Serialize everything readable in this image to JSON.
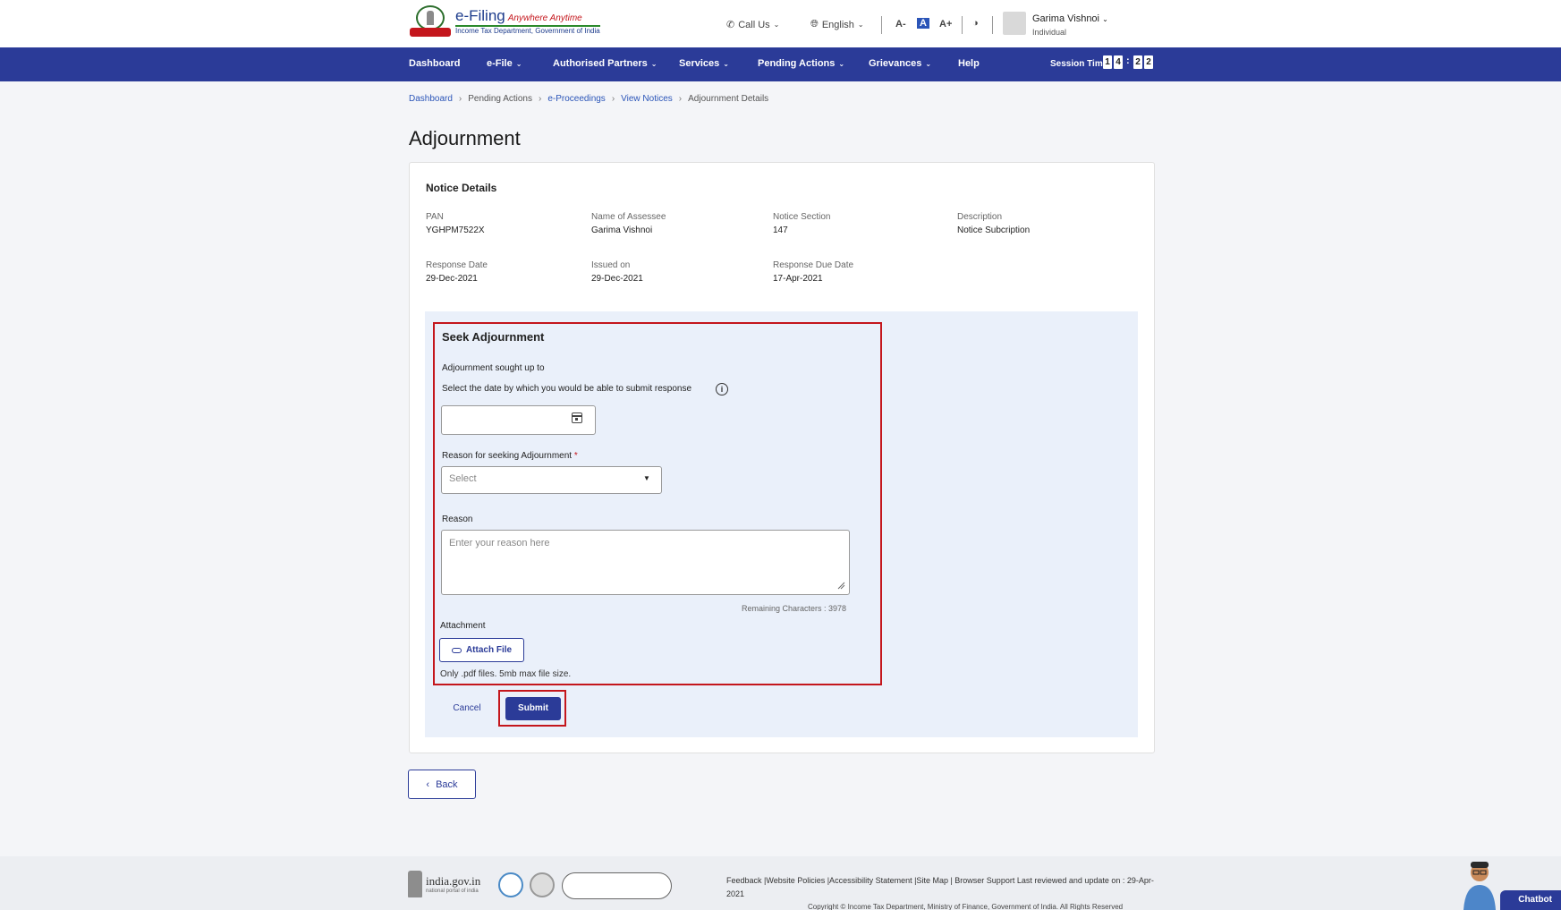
{
  "header": {
    "logo_main": "e-Filing",
    "logo_tagline": "Anywhere Anytime",
    "logo_sub": "Income Tax Department, Government of India",
    "call_us": "Call Us",
    "language": "English",
    "font_decrease": "A-",
    "font_normal": "A",
    "font_increase": "A+",
    "user_name": "Garima Vishnoi",
    "user_role": "Individual"
  },
  "nav": {
    "items": [
      {
        "label": "Dashboard"
      },
      {
        "label": "e-File"
      },
      {
        "label": "Authorised Partners"
      },
      {
        "label": "Services"
      },
      {
        "label": "Pending Actions"
      },
      {
        "label": "Grievances"
      },
      {
        "label": "Help"
      }
    ],
    "session_label": "Session Time",
    "session_digits": [
      "1",
      "4",
      "2",
      "2"
    ]
  },
  "breadcrumb": [
    "Dashboard",
    "Pending Actions",
    "e-Proceedings",
    "View Notices",
    "Adjournment Details"
  ],
  "page_title": "Adjournment",
  "notice": {
    "title": "Notice Details",
    "pan_label": "PAN",
    "pan": "YGHPM7522X",
    "assessee_label": "Name of Assessee",
    "assessee": "Garima Vishnoi",
    "section_label": "Notice Section",
    "section": "147",
    "description_label": "Description",
    "description": "Notice Subcription",
    "response_date_label": "Response Date",
    "response_date": "29-Dec-2021",
    "issued_label": "Issued on",
    "issued": "29-Dec-2021",
    "due_label": "Response Due Date",
    "due": "17-Apr-2021"
  },
  "seek": {
    "title": "Seek Adjournment",
    "sought_label": "Adjournment sought up to",
    "date_hint": "Select the date by which you would be able to submit response",
    "date_value": "",
    "reason_select_label": "Reason for seeking Adjournment",
    "required_mark": "*",
    "reason_select_value": "Select",
    "reason_label": "Reason",
    "reason_placeholder": "Enter your reason here",
    "remaining": "Remaining Characters : 3978",
    "attachment_label": "Attachment",
    "attach_button": "Attach File",
    "attach_hint": "Only .pdf files. 5mb max file size.",
    "cancel": "Cancel",
    "submit": "Submit"
  },
  "back_button": "Back",
  "footer": {
    "india_main": "india.gov.in",
    "india_sub": "national portal of india",
    "links": "Feedback |Website Policies |Accessibility Statement |Site Map | Browser Support   Last reviewed and update on : 29-Apr-2021",
    "copyright": "Copyright © Income Tax Department, Ministry of Finance, Government of India. All Rights Reserved"
  },
  "chatbot": "Chatbot",
  "colors": {
    "primary": "#2b3b98",
    "highlight": "#c4161c",
    "panel": "#eaf0fa"
  }
}
